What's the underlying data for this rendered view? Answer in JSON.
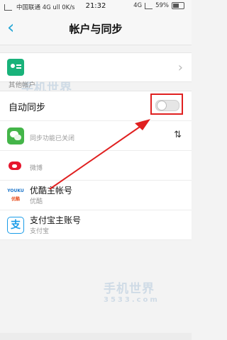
{
  "status_bar": {
    "left_text": "中国联通 4G ull 0K/s",
    "time": "21:32",
    "network": "4G",
    "battery": "59%"
  },
  "header": {
    "title": "帐户与同步"
  },
  "section": {
    "other_accounts_label": "其他帐户"
  },
  "sync_row": {
    "label": "自动同步"
  },
  "accounts": [
    {
      "name": "",
      "subtitle": "同步功能已关闭",
      "icon": "wechat-icon",
      "sync_icon": "sync-off-icon"
    },
    {
      "name": "",
      "subtitle": "微博",
      "icon": "weibo-icon"
    },
    {
      "name": "优酷主帐号",
      "subtitle": "优酷",
      "icon": "youku-icon"
    },
    {
      "name": "支付宝主账号",
      "subtitle": "支付宝",
      "icon": "alipay-icon"
    }
  ],
  "youku_logo": {
    "line1": "YOUKU",
    "line2": "优酷"
  },
  "alipay_logo": "支",
  "watermark": {
    "text": "手机世界",
    "number": "3533.com"
  },
  "colors": {
    "accent": "#2aa8d6",
    "highlight_border": "#e02020",
    "arrow": "#e02020"
  }
}
